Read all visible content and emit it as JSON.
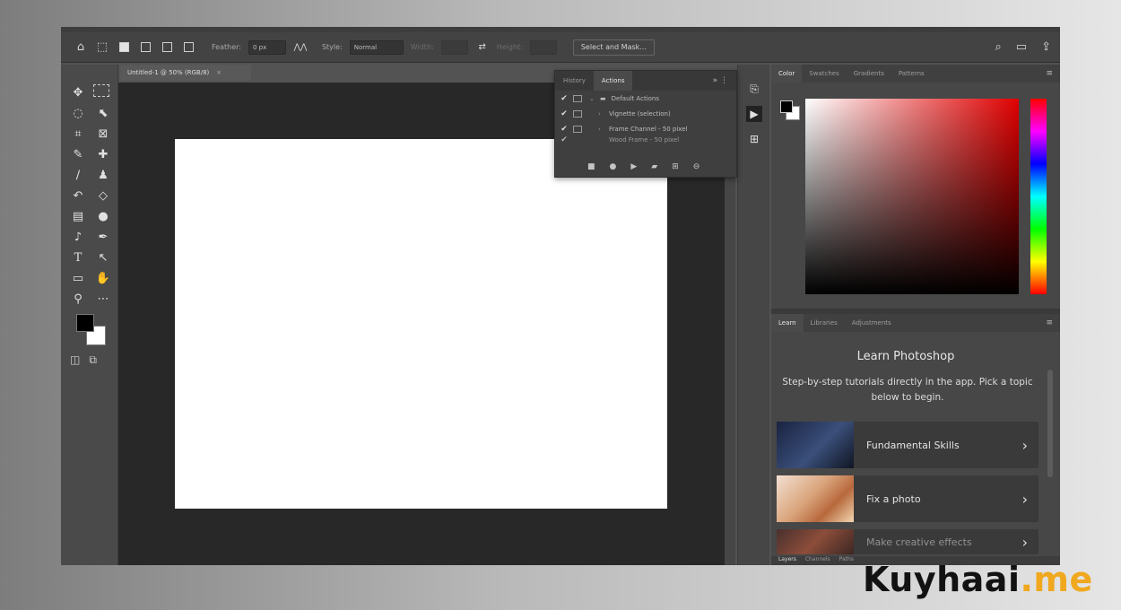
{
  "options_bar": {
    "feather_label": "Feather:",
    "feather_value": "0 px",
    "style_label": "Style:",
    "style_value": "Normal",
    "width_label": "Width:",
    "height_label": "Height:",
    "select_mask": "Select and Mask..."
  },
  "document_tab": {
    "title": "Untitled-1 @ 50% (RGB/8)"
  },
  "actions_panel": {
    "tabs": [
      "History",
      "Actions"
    ],
    "rows": [
      "Default Actions",
      "Vignette (selection)",
      "Frame Channel - 50 pixel",
      "Wood Frame - 50 pixel"
    ]
  },
  "color_panel": {
    "tabs": [
      "Color",
      "Swatches",
      "Gradients",
      "Patterns"
    ]
  },
  "learn_panel": {
    "tabs": [
      "Learn",
      "Libraries",
      "Adjustments"
    ],
    "title": "Learn Photoshop",
    "subtitle": "Step-by-step tutorials directly in the app. Pick a topic below to begin.",
    "cards": [
      "Fundamental Skills",
      "Fix a photo",
      "Make creative effects"
    ]
  },
  "bottom_tabs": [
    "Layers",
    "Channels",
    "Paths"
  ],
  "watermark": {
    "main": "Kuyhaai",
    "suffix": ".me"
  }
}
